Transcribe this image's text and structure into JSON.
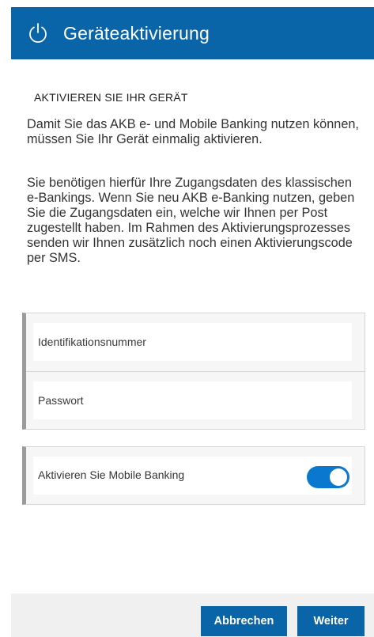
{
  "header": {
    "title": "Geräteaktivierung",
    "icon": "power-icon",
    "background": "#0a64a8"
  },
  "section": {
    "heading": "AKTIVIEREN SIE IHR GERÄT",
    "intro": "Damit Sie das AKB e- und Mobile Banking nutzen können, müssen Sie Ihr Gerät einmalig aktivieren.",
    "info": "Sie benötigen hierfür Ihre Zugangsdaten des klassischen e-Bankings. Wenn Sie neu AKB e-Banking nutzen, geben Sie die Zugangsdaten ein, welche wir Ihnen per Post zugestellt haben. Im Rahmen des Aktivierungsprozesses senden wir Ihnen zusätzlich noch einen Aktivierungscode per SMS."
  },
  "form": {
    "id_placeholder": "Identifikationsnummer",
    "id_value": "",
    "password_placeholder": "Passwort",
    "password_value": ""
  },
  "mobile_banking": {
    "label": "Aktivieren Sie Mobile Banking",
    "enabled": true,
    "accent": "#0a78cf"
  },
  "footer": {
    "cancel_label": "Abbrechen",
    "next_label": "Weiter"
  }
}
